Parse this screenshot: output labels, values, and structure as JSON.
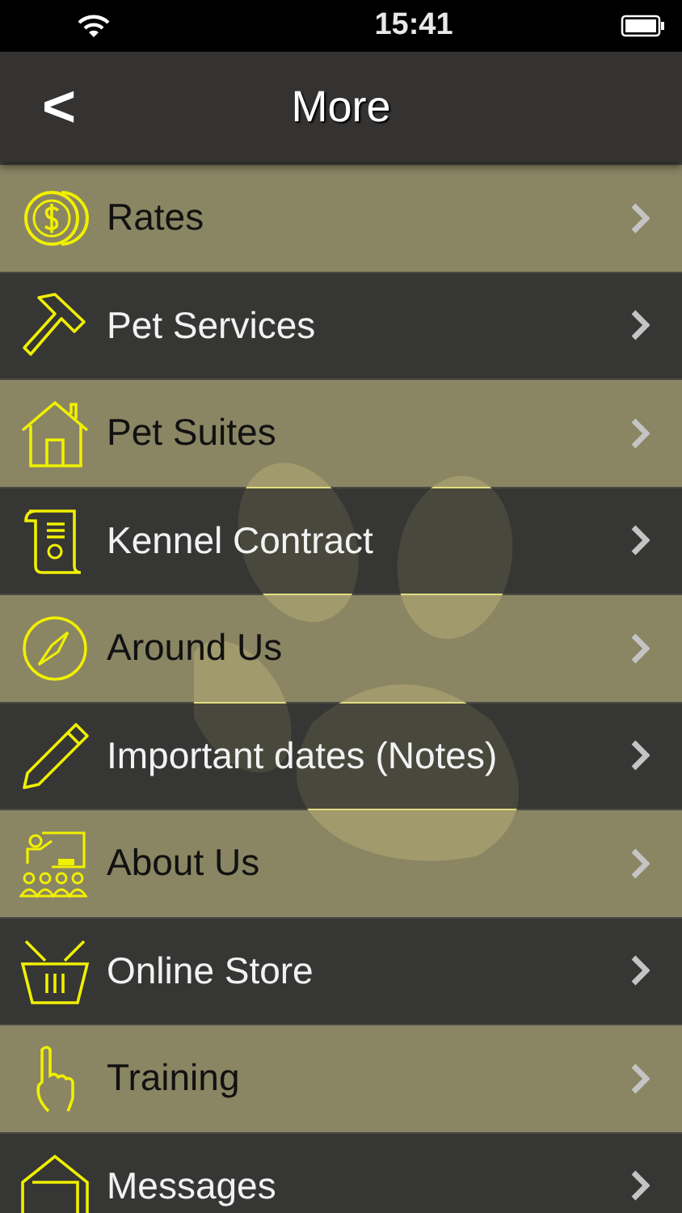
{
  "status_bar": {
    "time": "15:41"
  },
  "nav_bar": {
    "back": "<",
    "title": "More"
  },
  "menu": [
    {
      "label": "Rates",
      "kind": "light"
    },
    {
      "label": "Pet Services",
      "kind": "dark"
    },
    {
      "label": "Pet Suites",
      "kind": "light"
    },
    {
      "label": "Kennel Contract",
      "kind": "dark"
    },
    {
      "label": "Around Us",
      "kind": "light"
    },
    {
      "label": "Important dates (Notes)",
      "kind": "dark"
    },
    {
      "label": "About Us",
      "kind": "light"
    },
    {
      "label": "Online Store",
      "kind": "dark"
    },
    {
      "label": "Training",
      "kind": "light"
    },
    {
      "label": "Messages",
      "kind": "dark"
    }
  ]
}
